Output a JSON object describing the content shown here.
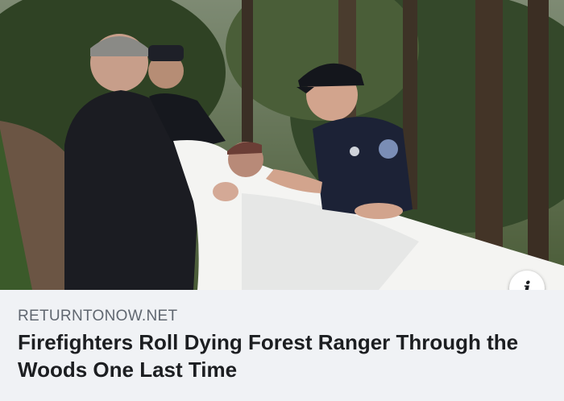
{
  "link_preview": {
    "image_description_icon": "photo",
    "info_button_symbol": "i",
    "info_icon": "info-icon",
    "source_domain": "RETURNTONOW.NET",
    "headline": "Firefighters Roll Dying Forest Ranger Through the Woods One Last Time"
  },
  "colors": {
    "footer_background": "#f0f2f5",
    "domain_text": "#606770",
    "headline_text": "#1c1e21"
  }
}
